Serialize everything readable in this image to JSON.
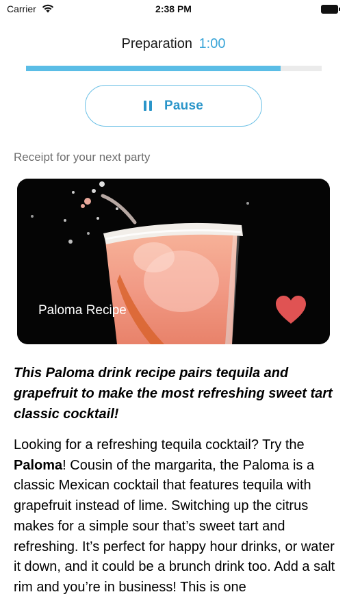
{
  "status_bar": {
    "carrier": "Carrier",
    "time": "2:38 PM"
  },
  "timer": {
    "label": "Preparation",
    "time": "1:00",
    "progress": 0.86
  },
  "controls": {
    "pause_label": "Pause"
  },
  "section": {
    "subtitle": "Receipt for your next party"
  },
  "card": {
    "title": "Paloma Recipe",
    "favorited": true
  },
  "article": {
    "lead": "This Paloma drink recipe pairs tequila and grapefruit to make the most refreshing sweet tart classic cocktail!",
    "body_part1": "Looking for a refreshing tequila cocktail? Try the ",
    "body_bold": "Paloma",
    "body_part2": "! Cousin of the margarita, the Paloma is a classic Mexican cocktail that features tequila with grapefruit instead of lime. Switching up the citrus makes for a simple sour that’s sweet tart and refreshing. It’s perfect for happy hour drinks, or water it down, and it could be a brunch drink too. Add a salt rim and you’re in business! This is one"
  },
  "colors": {
    "accent": "#2a95c9",
    "progress": "#5bbde6",
    "heart": "#e05353"
  }
}
